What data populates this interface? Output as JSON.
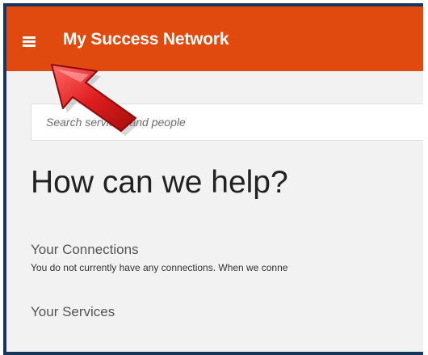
{
  "header": {
    "title": "My Success Network",
    "menu_icon": "hamburger-menu-icon",
    "color": "#e04a0f"
  },
  "search": {
    "placeholder": "Search services and people",
    "value": ""
  },
  "main": {
    "heading": "How can we help?",
    "connections": {
      "title": "Your Connections",
      "text": "You do not currently have any connections. When we conne"
    },
    "services": {
      "title": "Your Services"
    }
  },
  "annotation": {
    "arrow_icon": "red-pointer-arrow-icon",
    "color": "#d81c1c"
  }
}
